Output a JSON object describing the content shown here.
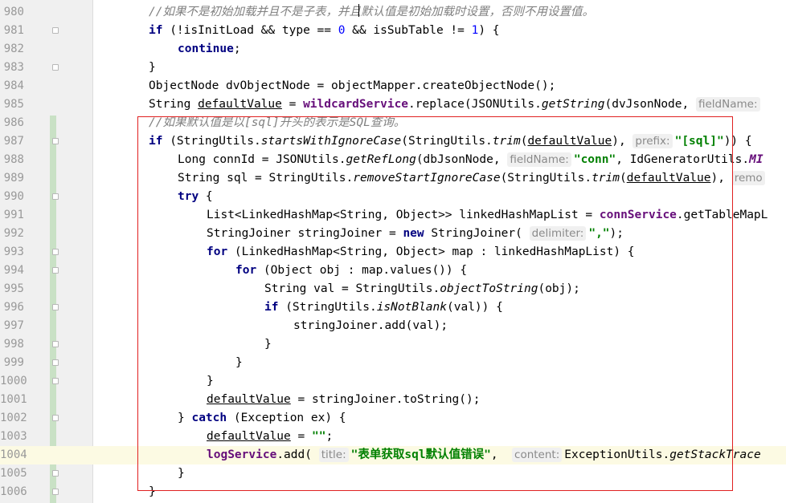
{
  "editor": {
    "lines": [
      {
        "no": "980",
        "fold": false,
        "hl": false,
        "indent": 0,
        "tokens": [
          {
            "t": "comment",
            "v": "//如果不是初始加载并且不是子表，并且默认值是初始加载时设置，否则不用设置值。"
          }
        ]
      },
      {
        "no": "981",
        "fold": true,
        "hl": false,
        "indent": 0,
        "tokens": [
          {
            "t": "kw",
            "v": "if"
          },
          {
            "t": "plain",
            "v": " (!isInitLoad && type == "
          },
          {
            "t": "num",
            "v": "0"
          },
          {
            "t": "plain",
            "v": " && isSubTable != "
          },
          {
            "t": "num",
            "v": "1"
          },
          {
            "t": "plain",
            "v": ") {"
          }
        ]
      },
      {
        "no": "982",
        "fold": false,
        "hl": false,
        "indent": 1,
        "tokens": [
          {
            "t": "kw",
            "v": "continue"
          },
          {
            "t": "plain",
            "v": ";"
          }
        ]
      },
      {
        "no": "983",
        "fold": true,
        "hl": false,
        "indent": 0,
        "tokens": [
          {
            "t": "plain",
            "v": "}"
          }
        ]
      },
      {
        "no": "984",
        "fold": false,
        "hl": false,
        "indent": 0,
        "tokens": [
          {
            "t": "plain",
            "v": "ObjectNode dvObjectNode = objectMapper.createObjectNode();"
          }
        ]
      },
      {
        "no": "985",
        "fold": false,
        "hl": false,
        "indent": 0,
        "tokens": [
          {
            "t": "plain",
            "v": "String "
          },
          {
            "t": "var",
            "v": "defaultValue"
          },
          {
            "t": "plain",
            "v": " = "
          },
          {
            "t": "field",
            "v": "wildcardService"
          },
          {
            "t": "plain",
            "v": ".replace(JSONUtils."
          },
          {
            "t": "static",
            "v": "getString"
          },
          {
            "t": "plain",
            "v": "(dvJsonNode, "
          },
          {
            "t": "hint",
            "v": "fieldName:"
          }
        ]
      },
      {
        "no": "986",
        "fold": false,
        "hl": false,
        "indent": 0,
        "tokens": [
          {
            "t": "comment",
            "v": "//如果默认值是以[sql]开头的表示是SQL查询。"
          }
        ]
      },
      {
        "no": "987",
        "fold": true,
        "hl": false,
        "indent": 0,
        "tokens": [
          {
            "t": "kw",
            "v": "if"
          },
          {
            "t": "plain",
            "v": " (StringUtils."
          },
          {
            "t": "static",
            "v": "startsWithIgnoreCase"
          },
          {
            "t": "plain",
            "v": "(StringUtils."
          },
          {
            "t": "static",
            "v": "trim"
          },
          {
            "t": "plain",
            "v": "("
          },
          {
            "t": "var",
            "v": "defaultValue"
          },
          {
            "t": "plain",
            "v": "), "
          },
          {
            "t": "hint",
            "v": "prefix:"
          },
          {
            "t": "str",
            "v": "\"[sql]\""
          },
          {
            "t": "plain",
            "v": ")) {"
          }
        ]
      },
      {
        "no": "988",
        "fold": false,
        "hl": false,
        "indent": 1,
        "tokens": [
          {
            "t": "plain",
            "v": "Long connId = JSONUtils."
          },
          {
            "t": "static",
            "v": "getRefLong"
          },
          {
            "t": "plain",
            "v": "(dbJsonNode, "
          },
          {
            "t": "hint",
            "v": "fieldName:"
          },
          {
            "t": "str",
            "v": "\"conn\""
          },
          {
            "t": "plain",
            "v": ", IdGeneratorUtils."
          },
          {
            "t": "staticfield",
            "v": "MI"
          }
        ]
      },
      {
        "no": "989",
        "fold": false,
        "hl": false,
        "indent": 1,
        "tokens": [
          {
            "t": "plain",
            "v": "String sql = StringUtils."
          },
          {
            "t": "static",
            "v": "removeStartIgnoreCase"
          },
          {
            "t": "plain",
            "v": "(StringUtils."
          },
          {
            "t": "static",
            "v": "trim"
          },
          {
            "t": "plain",
            "v": "("
          },
          {
            "t": "var",
            "v": "defaultValue"
          },
          {
            "t": "plain",
            "v": "), "
          },
          {
            "t": "hint",
            "v": "remo"
          }
        ]
      },
      {
        "no": "990",
        "fold": true,
        "hl": false,
        "indent": 1,
        "tokens": [
          {
            "t": "kw",
            "v": "try"
          },
          {
            "t": "plain",
            "v": " {"
          }
        ]
      },
      {
        "no": "991",
        "fold": false,
        "hl": false,
        "indent": 2,
        "tokens": [
          {
            "t": "plain",
            "v": "List<LinkedHashMap<String, Object>> linkedHashMapList = "
          },
          {
            "t": "field",
            "v": "connService"
          },
          {
            "t": "plain",
            "v": ".getTableMapL"
          }
        ]
      },
      {
        "no": "992",
        "fold": false,
        "hl": false,
        "indent": 2,
        "tokens": [
          {
            "t": "plain",
            "v": "StringJoiner stringJoiner = "
          },
          {
            "t": "kw",
            "v": "new"
          },
          {
            "t": "plain",
            "v": " StringJoiner( "
          },
          {
            "t": "hint",
            "v": "delimiter:"
          },
          {
            "t": "str",
            "v": "\",\""
          },
          {
            "t": "plain",
            "v": ");"
          }
        ]
      },
      {
        "no": "993",
        "fold": true,
        "hl": false,
        "indent": 2,
        "tokens": [
          {
            "t": "kw",
            "v": "for"
          },
          {
            "t": "plain",
            "v": " (LinkedHashMap<String, Object> map : linkedHashMapList) {"
          }
        ]
      },
      {
        "no": "994",
        "fold": true,
        "hl": false,
        "indent": 3,
        "tokens": [
          {
            "t": "kw",
            "v": "for"
          },
          {
            "t": "plain",
            "v": " (Object obj : map.values()) {"
          }
        ]
      },
      {
        "no": "995",
        "fold": false,
        "hl": false,
        "indent": 4,
        "tokens": [
          {
            "t": "plain",
            "v": "String val = StringUtils."
          },
          {
            "t": "static",
            "v": "objectToString"
          },
          {
            "t": "plain",
            "v": "(obj);"
          }
        ]
      },
      {
        "no": "996",
        "fold": true,
        "hl": false,
        "indent": 4,
        "tokens": [
          {
            "t": "kw",
            "v": "if"
          },
          {
            "t": "plain",
            "v": " (StringUtils."
          },
          {
            "t": "static",
            "v": "isNotBlank"
          },
          {
            "t": "plain",
            "v": "(val)) {"
          }
        ]
      },
      {
        "no": "997",
        "fold": false,
        "hl": false,
        "indent": 5,
        "tokens": [
          {
            "t": "plain",
            "v": "stringJoiner.add(val);"
          }
        ]
      },
      {
        "no": "998",
        "fold": true,
        "hl": false,
        "indent": 4,
        "tokens": [
          {
            "t": "plain",
            "v": "}"
          }
        ]
      },
      {
        "no": "999",
        "fold": true,
        "hl": false,
        "indent": 3,
        "tokens": [
          {
            "t": "plain",
            "v": "}"
          }
        ]
      },
      {
        "no": "1000",
        "fold": true,
        "hl": false,
        "indent": 2,
        "tokens": [
          {
            "t": "plain",
            "v": "}"
          }
        ]
      },
      {
        "no": "1001",
        "fold": false,
        "hl": false,
        "indent": 2,
        "tokens": [
          {
            "t": "var",
            "v": "defaultValue"
          },
          {
            "t": "plain",
            "v": " = stringJoiner.toString();"
          }
        ]
      },
      {
        "no": "1002",
        "fold": true,
        "hl": false,
        "indent": 1,
        "tokens": [
          {
            "t": "plain",
            "v": "} "
          },
          {
            "t": "kw",
            "v": "catch"
          },
          {
            "t": "plain",
            "v": " (Exception ex) {"
          }
        ]
      },
      {
        "no": "1003",
        "fold": false,
        "hl": false,
        "indent": 2,
        "tokens": [
          {
            "t": "var",
            "v": "defaultValue"
          },
          {
            "t": "plain",
            "v": " = "
          },
          {
            "t": "str",
            "v": "\"\""
          },
          {
            "t": "plain",
            "v": ";"
          }
        ]
      },
      {
        "no": "1004",
        "fold": false,
        "hl": true,
        "indent": 2,
        "tokens": [
          {
            "t": "field",
            "v": "logService"
          },
          {
            "t": "plain",
            "v": ".add( "
          },
          {
            "t": "hint",
            "v": "title:"
          },
          {
            "t": "str",
            "v": "\"表单获取sql默认值错误\""
          },
          {
            "t": "plain",
            "v": ",  "
          },
          {
            "t": "hint",
            "v": "content:"
          },
          {
            "t": "plain",
            "v": "ExceptionUtils."
          },
          {
            "t": "static",
            "v": "getStackTrace"
          }
        ]
      },
      {
        "no": "1005",
        "fold": true,
        "hl": false,
        "indent": 1,
        "tokens": [
          {
            "t": "plain",
            "v": "}"
          }
        ]
      },
      {
        "no": "1006",
        "fold": true,
        "hl": false,
        "indent": 0,
        "tokens": [
          {
            "t": "plain",
            "v": "}"
          }
        ]
      }
    ]
  },
  "colors": {
    "keyword": "#000080",
    "string": "#008000",
    "field": "#660e7a",
    "comment": "#808080",
    "number": "#0000ff",
    "annotation_box": "#e02020",
    "current_line": "#fcfae3",
    "vcs_changed": "#c9e1c5"
  }
}
